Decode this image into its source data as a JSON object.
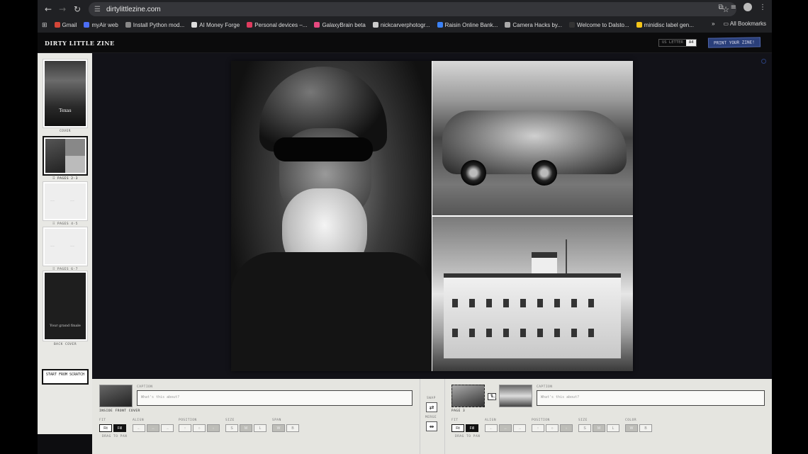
{
  "browser": {
    "url": "dirtylittlezine.com",
    "bookmarks": [
      {
        "label": "Gmail",
        "color": "#d44638"
      },
      {
        "label": "myAir web",
        "color": "#4c6ef5"
      },
      {
        "label": "Install Python mod...",
        "color": "#888888"
      },
      {
        "label": "AI Money Forge",
        "color": "#dddddd"
      },
      {
        "label": "Personal devices –...",
        "color": "#e03c5f"
      },
      {
        "label": "GalaxyBrain beta",
        "color": "#e64980"
      },
      {
        "label": "nickcarverphotogr...",
        "color": "#cccccc"
      },
      {
        "label": "Raisin Online Bank...",
        "color": "#3b82f6"
      },
      {
        "label": "Camera Hacks by...",
        "color": "#aaaaaa"
      },
      {
        "label": "Welcome to Dalsto...",
        "color": "#333333"
      },
      {
        "label": "minidisc label gen...",
        "color": "#f5c518"
      }
    ],
    "all_bookmarks": "All Bookmarks",
    "more": "»"
  },
  "header": {
    "logo": "DIRTY LITTLE ZINE",
    "paper_sizes": [
      "US LETTER",
      "A4"
    ],
    "selected_paper": "A4",
    "print_button": "PRINT YOUR ZINE!"
  },
  "sidebar": {
    "pages": [
      {
        "label": "COVER",
        "text": "Texas"
      },
      {
        "label": "⠿ PAGES 2-3"
      },
      {
        "label": "⠿ PAGES 4-5"
      },
      {
        "label": "⠿ PAGES 6-7"
      },
      {
        "label": "BACK COVER",
        "text": "Your grand finale"
      }
    ],
    "selected_index": 1,
    "start_button": "START FROM SCRATCH"
  },
  "panel_left": {
    "caption_label": "CAPTION",
    "caption_placeholder": "What's this about?",
    "page_name": "INSIDE FRONT COVER",
    "fit_label": "FIT",
    "fit_options": [
      "Fit",
      "Fill"
    ],
    "fit_selected": "Fill",
    "align_label": "ALIGN",
    "align_options": [
      "←",
      "↔",
      "→"
    ],
    "position_label": "POSITION",
    "position_options": [
      "↑",
      "○",
      "↓"
    ],
    "size_label": "SIZE",
    "size_options": [
      "S",
      "M",
      "L"
    ],
    "span_label": "SPAN",
    "span_options": [
      "W",
      "B"
    ],
    "drag_hint": "DRAG TO PAN"
  },
  "middle": {
    "swap_label": "SWAP",
    "swap_icon": "⇄",
    "merge_label": "MERGE",
    "merge_icon": "⇹"
  },
  "panel_right": {
    "caption_label": "CAPTION",
    "caption_placeholder": "What's this about?",
    "page_name": "PAGE 3",
    "fit_label": "FIT",
    "fit_options": [
      "Fit",
      "Fill"
    ],
    "fit_selected": "Fill",
    "align_label": "ALIGN",
    "align_options": [
      "←",
      "↔",
      "→"
    ],
    "position_label": "POSITION",
    "position_options": [
      "↑",
      "○",
      "↓"
    ],
    "size_label": "SIZE",
    "size_options": [
      "S",
      "M",
      "L"
    ],
    "color_label": "COLOR",
    "color_options": [
      "W",
      "B"
    ],
    "drag_hint": "DRAG TO PAN",
    "split_icon": "⇅"
  }
}
